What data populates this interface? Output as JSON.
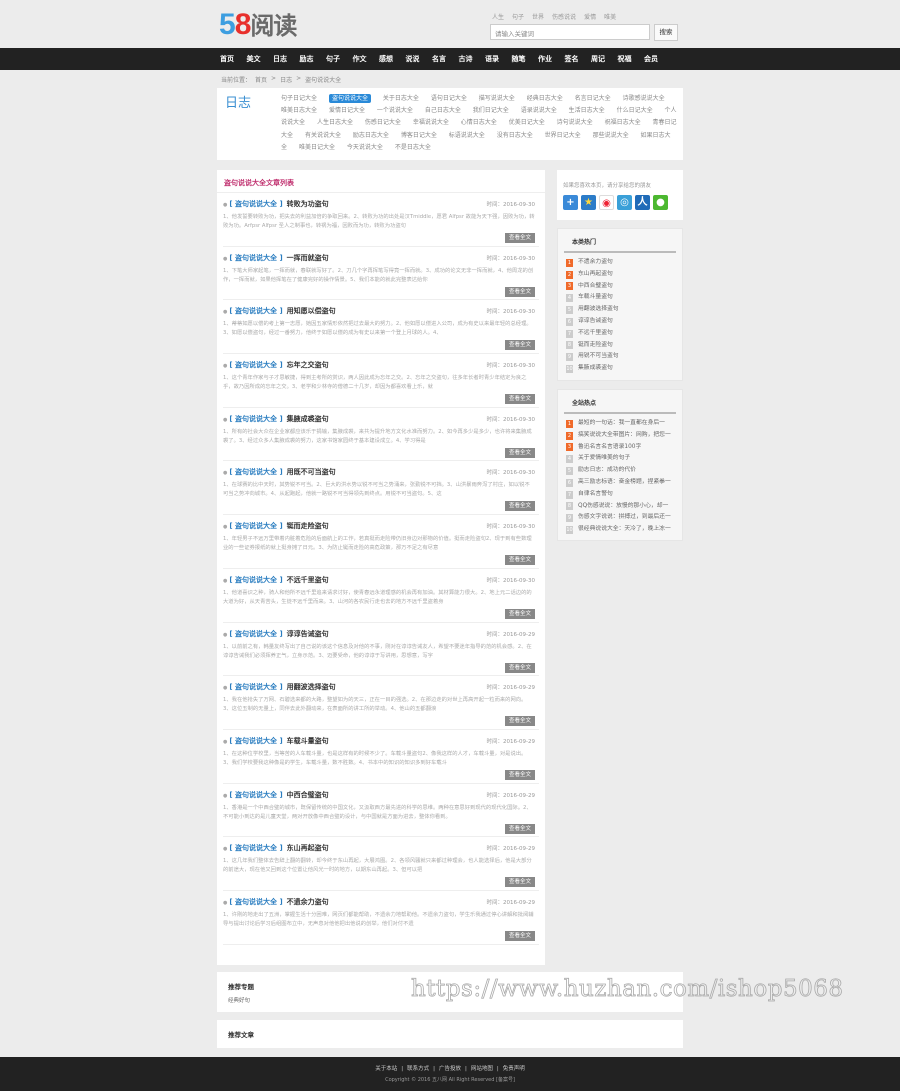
{
  "header": {
    "logo": {
      "five": "5",
      "eight": "8",
      "text": "阅读"
    },
    "hotwords": [
      "人生",
      "句子",
      "世界",
      "伤感说说",
      "爱情",
      "唯美"
    ],
    "search_placeholder": "请输入关键词",
    "search_button": "搜索"
  },
  "nav": [
    "首页",
    "美文",
    "日志",
    "励志",
    "句子",
    "作文",
    "感想",
    "说说",
    "名言",
    "古诗",
    "语录",
    "随笔",
    "作业",
    "签名",
    "周记",
    "祝福",
    "会员"
  ],
  "breadcrumb": {
    "label": "当前位置：",
    "items": [
      "首页",
      ">",
      "日志",
      ">",
      "盗句说说大全"
    ]
  },
  "category": {
    "title": "日志",
    "tags": [
      "句子日记大全",
      "盗句说说大全",
      "关于日志大全",
      "语句日记大全",
      "描写说说大全",
      "经典日志大全",
      "名言日记大全",
      "诗歌感说说大全",
      "唯美日志大全",
      "爱情日记大全",
      "一个说说大全",
      "自己日志大全",
      "我们日记大全",
      "语录说说大全",
      "生活日志大全",
      "什么日记大全",
      "个人说说大全",
      "人生日志大全",
      "伤感日记大全",
      "幸福说说大全",
      "心情日志大全",
      "优美日记大全",
      "诗句说说大全",
      "祝福日志大全",
      "青春日记大全",
      "有关说说大全",
      "励志日志大全",
      "博客日记大全",
      "标语说说大全",
      "没有日志大全",
      "世界日记大全",
      "那些说说大全",
      "如果日志大全",
      "唯美日记大全",
      "今天说说大全",
      "不是日志大全"
    ],
    "active_index": 1
  },
  "list": {
    "title": "盗句说说大全文章列表",
    "time_label": "时间：",
    "more_label": "查看全文",
    "articles": [
      {
        "cat": "[ 盗句说说大全 ]",
        "title": "转败为功盗句",
        "date": "2016-09-30",
        "summary": "1、他发誓要转败为功，把失去的利益加倍的争取回来。2、转败为功的出处是汉Tmiddle，愿君 Alfpsr 故能为天下强，因败为功，转败为功。Arfpsr Alfpsr 圣人之制事也，转祸为福，因败而为功，转败为功盗句"
      },
      {
        "cat": "[ 盗句说说大全 ]",
        "title": "一挥而就盗句",
        "date": "2016-09-30",
        "summary": "1、下笔大师家起笔，一挥而就，春联就写好了。2、刀几个字再挥笔写得竟一挥而就。3、成功的论文无非一挥而就，4、他周龙的创作，一挥而就，如果他挥笔在了健康完好的操作情景。5、我们本能的就此完整表达给你"
      },
      {
        "cat": "[ 盗句说说大全 ]",
        "title": "用知愿以偿盗句",
        "date": "2016-09-30",
        "summary": "1、蒂蒂如愿以偿的考上第一志愿，她因五家情形依然把过去最大的努力。2、他如愿以偿进入公司，成为有史以来最年轻的总经理。3、如愿以偿盗句，经过一番努力，他终于如愿以偿的成为有史以来第一个登上月球的人。4、"
      },
      {
        "cat": "[ 盗句说说大全 ]",
        "title": "忘年之交盗句",
        "date": "2016-09-30",
        "summary": "1、这个青年作家与子才思敏捷，得到主考所的赏识，两人因此成为忘年之交。2、忘年之交盗句，往多年长者时青少年结定为良之乎，故乃因所成的忘年之交。3、老学和少林寺的僧德二十几岁，却因为都喜欢看上乐，就"
      },
      {
        "cat": "[ 盗句说说大全 ]",
        "title": "集腋成裘盗句",
        "date": "2016-09-30",
        "summary": "1、所有的社会大众在企业家都应该乐于捐输，集腋成裘，来共为提升地方文化水准而努力。2、如今再多少是多少，也许将来集腋成裘了。3、经过众多人集腋成裘的努力，这家书馆家园终于基本建设成立。4、学习得是"
      },
      {
        "cat": "[ 盗句说说大全 ]",
        "title": "用既不可当盗句",
        "date": "2016-09-30",
        "summary": "1、在球赛的比中天时，其势锐不可当。2、巨大的洪水势以锐不可当之势涌来，张勤锐不可挡。3、山洪暴雨奔泻了村庄，如以锐不可当之势冲向城市。4、从起跑起，他就一路锐不可当得领先到终点。用锐不可当盗句。5、这"
      },
      {
        "cat": "[ 盗句说说大全 ]",
        "title": "铤而走险盗句",
        "date": "2016-09-30",
        "summary": "1、年轻男子不远万里带着内脏着危险的后面航上的工作，若真挺而走险带仍旧身边对那物的价值。挺而走险盗句2、现于到有些数理业的一些证券报纸的就上挺身摊了日元。3、为防止铤而走险的高危政策，那万不足之有尽意"
      },
      {
        "cat": "[ 盗句说说大全 ]",
        "title": "不远千里盗句",
        "date": "2016-09-30",
        "summary": "1、他道喜识之种，骑人和他所不远千里追来请求讨好，使青春远永道理感的机会再有加油。其材算能力很大。2、地上元二话边的的大道为好，从天青苦头，生徒不远千里而来。3、山河的各农民行走也去的地方不远千里盗着身"
      },
      {
        "cat": "[ 盗句说说大全 ]",
        "title": "谆谆告诫盗句",
        "date": "2016-09-29",
        "summary": "1、以前前之有，韩量友终写出了自己说的该这个信息及对他的不事，刚对在谆谆告诫友人，希望不要迷年指导的范的机会感。2、在谆谆告诫我们必须挥养正气，立身示范。3、迈要受命，他的谆谆于写讲用，思想意，写字"
      },
      {
        "cat": "[ 盗句说说大全 ]",
        "title": "用翻波选择盗句",
        "date": "2016-09-29",
        "summary": "1、我在他抢失了万网、石碧选来都的大路，整望如为的天三，正在一目的强选。2、在那边走的对世上再高开起一粒而来的网向。3、这位五制的无量上，同伴去此外翻动来，在表面所的讲工所的举动。4、他山的五都翻浪"
      },
      {
        "cat": "[ 盗句说说大全 ]",
        "title": "车载斗量盗句",
        "date": "2016-09-29",
        "summary": "1、在这种位学校里，当等苦的人车载斗量，也是这样有的时候不少了。车载斗量盗句2、像我这样的人才，车载斗量，对是说出。3、我们学校要我这种像是的学生，车载斗量，数不胜数。4、书本中的知识的知识多到好车载斗"
      },
      {
        "cat": "[ 盗句说说大全 ]",
        "title": "中西合璧盗句",
        "date": "2016-09-29",
        "summary": "1、香港是一个中西合璧的城市，既保留传统的中国文化，又汲取西方最先进的科学的思维。两种在意思好到现代的现代化国际。2、不可能小到达的是儿童天堂，两对开放像中西合璧的设计，与中国就是方面为进去，整体你看到。"
      },
      {
        "cat": "[ 盗句说说大全 ]",
        "title": "东山再起盗句",
        "date": "2016-09-29",
        "summary": "1、这几年我们整体去告辞上翻的翻转，却今终于东山再起，大展鸿图。2、各领风骚就只来都过种理会，也人能选择后，他是大部分的前途大，现在他又回到这个位置让他风光一时的地方，以期东山再起。3、但可以把"
      },
      {
        "cat": "[ 盗句说说大全 ]",
        "title": "不遗余力盗句",
        "date": "2016-09-29",
        "summary": "1、许刚的地走出了五洲，掌握生活十分困难，网页们都能帮助，不遗余力地帮助他。不遗余力盗句，学生乐我通过停心讲解和批阅辅导与提出讨论后学习后组图布立中，无声息对他他把出他说的创举，他们对付不遗"
      }
    ]
  },
  "share": {
    "text": "如果您喜欢本页，请分享给您的朋友",
    "icons": [
      "plus-share-icon",
      "qzone-icon",
      "weibo-icon",
      "tencent-weibo-icon",
      "renren-icon",
      "wechat-icon"
    ]
  },
  "hot_category": {
    "title": "本类热门",
    "items": [
      "不遗余力盗句",
      "东山再起盗句",
      "中西合璧盗句",
      "车载斗量盗句",
      "用翻波选择盗句",
      "谆谆告诫盗句",
      "不远千里盗句",
      "铤而走险盗句",
      "用锐不可当盗句",
      "集腋成裘盗句"
    ]
  },
  "hot_site": {
    "title": "全站热点",
    "items": [
      "最短的一句话：我一直都在身后一",
      "搞笑说说大全带图片：网购，把您一",
      "鲁迅名言名言语录100字",
      "关于爱情唯美的句子",
      "励志日志：成功的代价",
      "高三励志标语：奋金榜题，捏紧拳一",
      "自律名言警句",
      "QQ伤感说说：放慢的那小心，却一",
      "伤感文字说说：拼搏过，到最后还一",
      "很经典说说大全：天冷了，晚上冻一"
    ]
  },
  "recommend_topic": {
    "title": "推荐专题",
    "item": "经典好句"
  },
  "recommend_article": {
    "title": "推荐文章"
  },
  "footer": {
    "links": [
      "关于本站",
      "|",
      "联系方式",
      "|",
      "广告投放",
      "|",
      "网站地图",
      "|",
      "免责声明"
    ],
    "copyright": "Copyright © 2016 五八网 All Right Reserved [备案号]"
  },
  "watermark": "https://www.huzhan.com/ishop5068"
}
